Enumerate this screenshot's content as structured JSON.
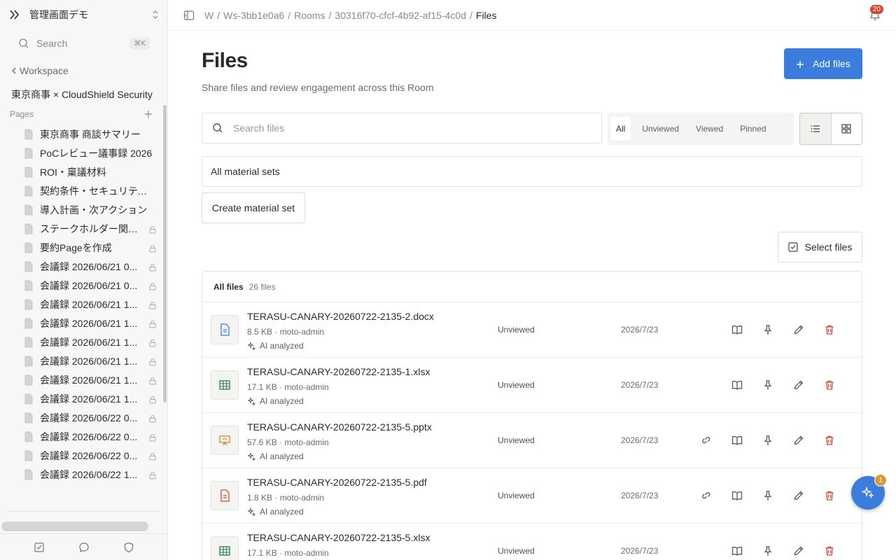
{
  "sidebar": {
    "workspace_name": "管理画面デモ",
    "search_placeholder": "Search",
    "search_shortcut": "⌘K",
    "back_label": "Workspace",
    "room_title": "東京商事 × CloudShield Security",
    "pages_label": "Pages",
    "pages": [
      {
        "title": "東京商事 商談サマリー",
        "locked": false
      },
      {
        "title": "PoCレビュー議事録 2026",
        "locked": false
      },
      {
        "title": "ROI・稟議材料",
        "locked": false
      },
      {
        "title": "契約条件・セキュリティ要件",
        "locked": false
      },
      {
        "title": "導入計画・次アクション",
        "locked": false
      },
      {
        "title": "ステークホルダー関係図",
        "locked": true
      },
      {
        "title": "要約Pageを作成",
        "locked": true
      },
      {
        "title": "会議録 2026/06/21 0...",
        "locked": true
      },
      {
        "title": "会議録 2026/06/21 0...",
        "locked": true
      },
      {
        "title": "会議録 2026/06/21 1...",
        "locked": true
      },
      {
        "title": "会議録 2026/06/21 1...",
        "locked": true
      },
      {
        "title": "会議録 2026/06/21 1...",
        "locked": true
      },
      {
        "title": "会議録 2026/06/21 1...",
        "locked": true
      },
      {
        "title": "会議録 2026/06/21 1...",
        "locked": true
      },
      {
        "title": "会議録 2026/06/21 1...",
        "locked": true
      },
      {
        "title": "会議録 2026/06/22 0...",
        "locked": true
      },
      {
        "title": "会議録 2026/06/22 0...",
        "locked": true
      },
      {
        "title": "会議録 2026/06/22 0...",
        "locked": true
      },
      {
        "title": "会議録 2026/06/22 1...",
        "locked": true
      }
    ]
  },
  "topbar": {
    "crumbs": [
      "W",
      "Ws-3bb1e0a6",
      "Rooms",
      "30316f70-cfcf-4b92-af15-4c0d"
    ],
    "current": "Files",
    "notifications": "20"
  },
  "main": {
    "title": "Files",
    "subtitle": "Share files and review engagement across this Room",
    "add_label": "Add files",
    "search_placeholder": "Search files",
    "filters": [
      "All",
      "Unviewed",
      "Viewed",
      "Pinned"
    ],
    "active_filter": "All",
    "sets_label": "All material sets",
    "create_set_label": "Create material set",
    "select_files_label": "Select files",
    "files_header": "All files",
    "files_count": "26 files",
    "assistant_badge": "1"
  },
  "files": [
    {
      "name": "TERASU-CANARY-20260722-2135-2.docx",
      "meta": "8.5 KB · moto-admin",
      "ai": "AI analyzed",
      "status": "Unviewed",
      "date": "2026/7/23",
      "kind": "doc",
      "link": false
    },
    {
      "name": "TERASU-CANARY-20260722-2135-1.xlsx",
      "meta": "17.1 KB · moto-admin",
      "ai": "AI analyzed",
      "status": "Unviewed",
      "date": "2026/7/23",
      "kind": "sheet",
      "link": false
    },
    {
      "name": "TERASU-CANARY-20260722-2135-5.pptx",
      "meta": "57.6 KB · moto-admin",
      "ai": "AI analyzed",
      "status": "Unviewed",
      "date": "2026/7/23",
      "kind": "slide",
      "link": true
    },
    {
      "name": "TERASU-CANARY-20260722-2135-5.pdf",
      "meta": "1.8 KB · moto-admin",
      "ai": "AI analyzed",
      "status": "Unviewed",
      "date": "2026/7/23",
      "kind": "pdf",
      "link": true
    },
    {
      "name": "TERASU-CANARY-20260722-2135-5.xlsx",
      "meta": "17.1 KB · moto-admin",
      "ai": "AI analyzed",
      "status": "Unviewed",
      "date": "2026/7/23",
      "kind": "sheet",
      "link": false
    }
  ],
  "colors": {
    "accent": "#3b7ddd",
    "danger": "#d64533",
    "doc": "#3b7ddd",
    "sheet": "#2f7a4f",
    "slide": "#d58a2a",
    "pdf": "#d64533"
  }
}
